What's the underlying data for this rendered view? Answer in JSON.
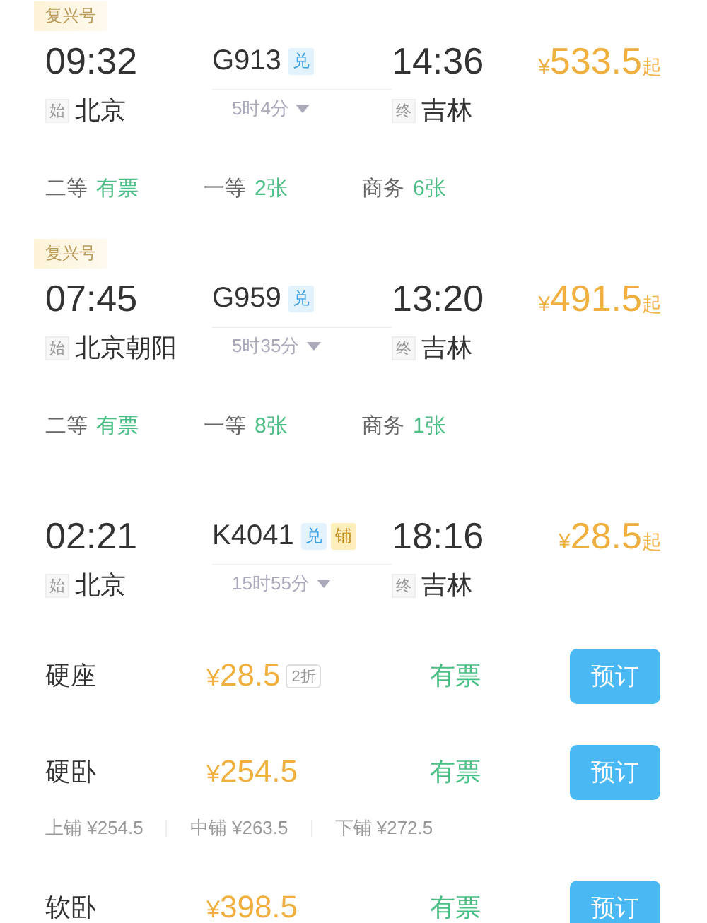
{
  "trains": [
    {
      "type_badge": "复兴号",
      "depart_time": "09:32",
      "train_no": "G913",
      "tags": [
        {
          "text": "兑",
          "kind": "exchange"
        }
      ],
      "arrive_time": "14:36",
      "price": {
        "currency": "¥",
        "amount": "533.5",
        "suffix": "起"
      },
      "origin": {
        "tag": "始",
        "name": "北京"
      },
      "duration": "5时4分",
      "destination": {
        "tag": "终",
        "name": "吉林"
      },
      "seats": [
        {
          "class": "二等",
          "availability": "有票"
        },
        {
          "class": "一等",
          "availability": "2张"
        },
        {
          "class": "商务",
          "availability": "6张"
        }
      ]
    },
    {
      "type_badge": "复兴号",
      "depart_time": "07:45",
      "train_no": "G959",
      "tags": [
        {
          "text": "兑",
          "kind": "exchange"
        }
      ],
      "arrive_time": "13:20",
      "price": {
        "currency": "¥",
        "amount": "491.5",
        "suffix": "起"
      },
      "origin": {
        "tag": "始",
        "name": "北京朝阳"
      },
      "duration": "5时35分",
      "destination": {
        "tag": "终",
        "name": "吉林"
      },
      "seats": [
        {
          "class": "二等",
          "availability": "有票"
        },
        {
          "class": "一等",
          "availability": "8张"
        },
        {
          "class": "商务",
          "availability": "1张"
        }
      ]
    },
    {
      "depart_time": "02:21",
      "train_no": "K4041",
      "tags": [
        {
          "text": "兑",
          "kind": "exchange"
        },
        {
          "text": "铺",
          "kind": "berth"
        }
      ],
      "arrive_time": "18:16",
      "price": {
        "currency": "¥",
        "amount": "28.5",
        "suffix": "起"
      },
      "origin": {
        "tag": "始",
        "name": "北京"
      },
      "duration": "15时55分",
      "destination": {
        "tag": "终",
        "name": "吉林"
      },
      "seat_options": [
        {
          "name": "硬座",
          "currency": "¥",
          "amount": "28.5",
          "discount": "2折",
          "availability": "有票",
          "button": "预订"
        },
        {
          "name": "硬卧",
          "currency": "¥",
          "amount": "254.5",
          "availability": "有票",
          "button": "预订",
          "berths": [
            {
              "name": "上铺",
              "price": "¥254.5"
            },
            {
              "name": "中铺",
              "price": "¥263.5"
            },
            {
              "name": "下铺",
              "price": "¥272.5"
            }
          ]
        },
        {
          "name": "软卧",
          "currency": "¥",
          "amount": "398.5",
          "availability": "有票",
          "button": "预订"
        }
      ]
    }
  ]
}
